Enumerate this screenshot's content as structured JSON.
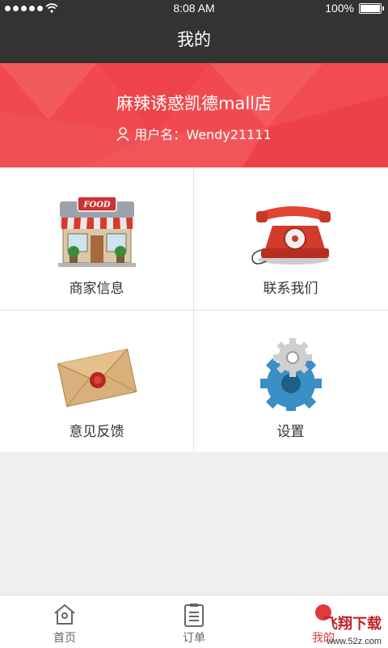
{
  "status_bar": {
    "time": "8:08 AM",
    "battery": "100%"
  },
  "header": {
    "title": "我的"
  },
  "profile": {
    "store_name": "麻辣诱惑凯德mall店",
    "username_label": "用户名：",
    "username": "Wendy21111"
  },
  "menu": {
    "items": [
      {
        "label": "商家信息",
        "icon": "storefront-icon"
      },
      {
        "label": "联系我们",
        "icon": "telephone-icon"
      },
      {
        "label": "意见反馈",
        "icon": "envelope-icon"
      },
      {
        "label": "设置",
        "icon": "gears-icon"
      }
    ]
  },
  "tabs": [
    {
      "label": "首页",
      "icon": "home-icon"
    },
    {
      "label": "订单",
      "icon": "order-list-icon"
    },
    {
      "label": "我的",
      "icon": "profile-icon"
    }
  ],
  "storefront_sign": "FOOD",
  "watermark": {
    "text": "飞翔下载",
    "url": "www.52z.com"
  },
  "colors": {
    "brand_red": "#f04a4f",
    "header_dark": "#333333"
  }
}
